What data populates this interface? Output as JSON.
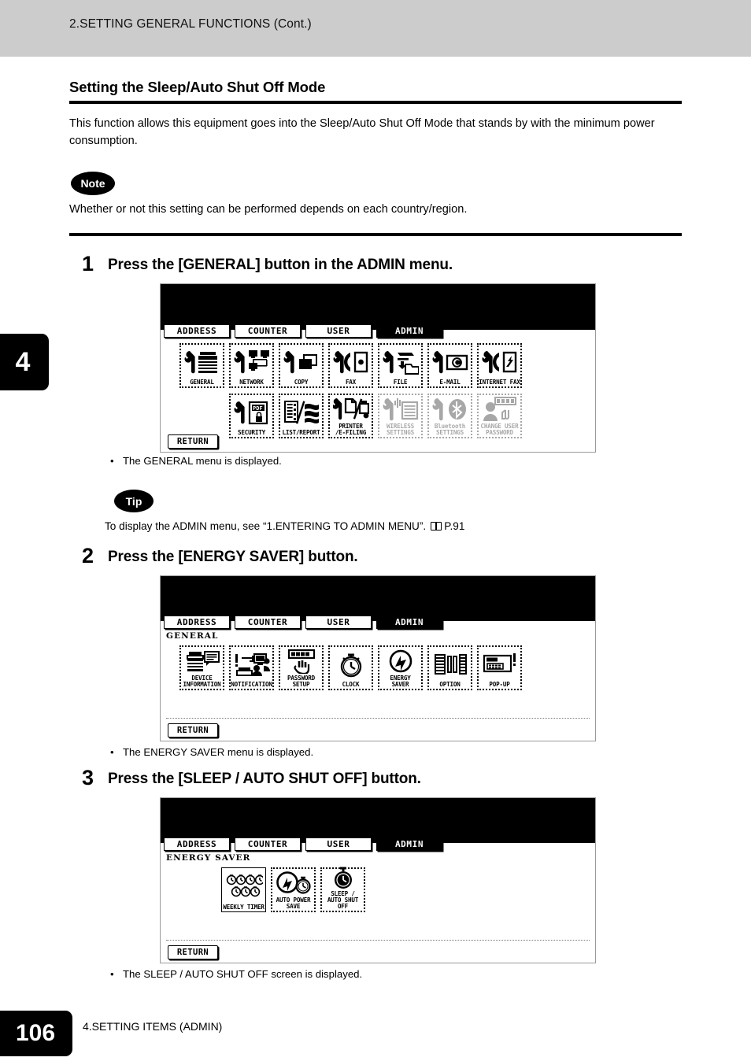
{
  "header": {
    "running_title": "2.SETTING GENERAL FUNCTIONS (Cont.)"
  },
  "chapter_tab": {
    "number": "4"
  },
  "section": {
    "title": "Setting the Sleep/Auto Shut Off Mode",
    "intro": "This function allows this equipment goes into the Sleep/Auto Shut Off Mode that stands by with the minimum power consumption.",
    "note_label": "Note",
    "note_text": "Whether or not this setting can be performed depends on each country/region.",
    "tip_label": "Tip",
    "tip_text": "To display the ADMIN menu, see “1.ENTERING TO ADMIN MENU”.",
    "tip_ref": "P.91"
  },
  "steps": [
    {
      "number": "1",
      "instruction": "Press the [GENERAL] button in the ADMIN menu.",
      "result": "The GENERAL menu is displayed."
    },
    {
      "number": "2",
      "instruction": "Press the [ENERGY SAVER] button.",
      "result": "The ENERGY SAVER menu is displayed."
    },
    {
      "number": "3",
      "instruction": "Press the [SLEEP / AUTO SHUT OFF] button.",
      "result": "The SLEEP / AUTO SHUT OFF screen is displayed."
    }
  ],
  "screens": [
    {
      "id": "admin-menu",
      "tabs": [
        {
          "label": "ADDRESS",
          "selected": false
        },
        {
          "label": "COUNTER",
          "selected": false
        },
        {
          "label": "USER",
          "selected": false
        },
        {
          "label": "ADMIN",
          "selected": true
        }
      ],
      "breadcrumb": "",
      "return_label": "RETURN",
      "row1": [
        {
          "label": "GENERAL",
          "icon": "wrench-copier-icon",
          "disabled": false
        },
        {
          "label": "NETWORK",
          "icon": "wrench-network-icon",
          "disabled": false
        },
        {
          "label": "COPY",
          "icon": "wrench-copy-icon",
          "disabled": false
        },
        {
          "label": "FAX",
          "icon": "wrench-fax-icon",
          "disabled": false
        },
        {
          "label": "FILE",
          "icon": "wrench-file-icon",
          "disabled": false
        },
        {
          "label": "E-MAIL",
          "icon": "wrench-email-icon",
          "disabled": false
        },
        {
          "label": "INTERNET FAX",
          "icon": "wrench-ifax-icon",
          "disabled": false
        }
      ],
      "row2": [
        {
          "label": "SECURITY",
          "icon": "wrench-pdf-lock-icon",
          "disabled": false
        },
        {
          "label": "LIST/REPORT",
          "icon": "list-report-icon",
          "disabled": false
        },
        {
          "label": "PRINTER\n/E-FILING",
          "icon": "wrench-printer-efile-icon",
          "disabled": false
        },
        {
          "label": "WIRELESS\nSETTINGS",
          "icon": "wrench-wireless-icon",
          "disabled": true
        },
        {
          "label": "Bluetooth\nSETTINGS",
          "icon": "wrench-bluetooth-icon",
          "disabled": true
        },
        {
          "label": "CHANGE USER\nPASSWORD",
          "icon": "user-password-icon",
          "disabled": true
        }
      ]
    },
    {
      "id": "general-menu",
      "tabs": [
        {
          "label": "ADDRESS",
          "selected": false
        },
        {
          "label": "COUNTER",
          "selected": false
        },
        {
          "label": "USER",
          "selected": false
        },
        {
          "label": "ADMIN",
          "selected": true
        }
      ],
      "breadcrumb": "GENERAL",
      "return_label": "RETURN",
      "row1": [
        {
          "label": "DEVICE\nINFORMATION",
          "icon": "device-information-icon",
          "disabled": false
        },
        {
          "label": "NOTIFICATION",
          "icon": "notification-icon",
          "disabled": false
        },
        {
          "label": "PASSWORD SETUP",
          "icon": "password-setup-icon",
          "disabled": false
        },
        {
          "label": "CLOCK",
          "icon": "clock-icon",
          "disabled": false
        },
        {
          "label": "ENERGY\nSAVER",
          "icon": "energy-saver-icon",
          "disabled": false
        },
        {
          "label": "OPTION",
          "icon": "option-icon",
          "disabled": false
        },
        {
          "label": "POP-UP",
          "icon": "pop-up-icon",
          "disabled": false
        }
      ],
      "row2": []
    },
    {
      "id": "energy-saver-menu",
      "tabs": [
        {
          "label": "ADDRESS",
          "selected": false
        },
        {
          "label": "COUNTER",
          "selected": false
        },
        {
          "label": "USER",
          "selected": false
        },
        {
          "label": "ADMIN",
          "selected": true
        }
      ],
      "breadcrumb": "ENERGY SAVER",
      "return_label": "RETURN",
      "row1": [
        {
          "label": "WEEKLY TIMER",
          "icon": "weekly-timer-icon",
          "disabled": false
        },
        {
          "label": "AUTO POWER\nSAVE",
          "icon": "auto-power-save-icon",
          "disabled": false
        },
        {
          "label": "SLEEP /\nAUTO SHUT OFF",
          "icon": "sleep-auto-shutoff-icon",
          "disabled": false
        }
      ],
      "row2": []
    }
  ],
  "footer": {
    "page_number": "106",
    "chapter_title": "4.SETTING ITEMS (ADMIN)"
  },
  "colors": {
    "header_band": "#cccccc",
    "ink": "#000000",
    "paper": "#ffffff"
  }
}
